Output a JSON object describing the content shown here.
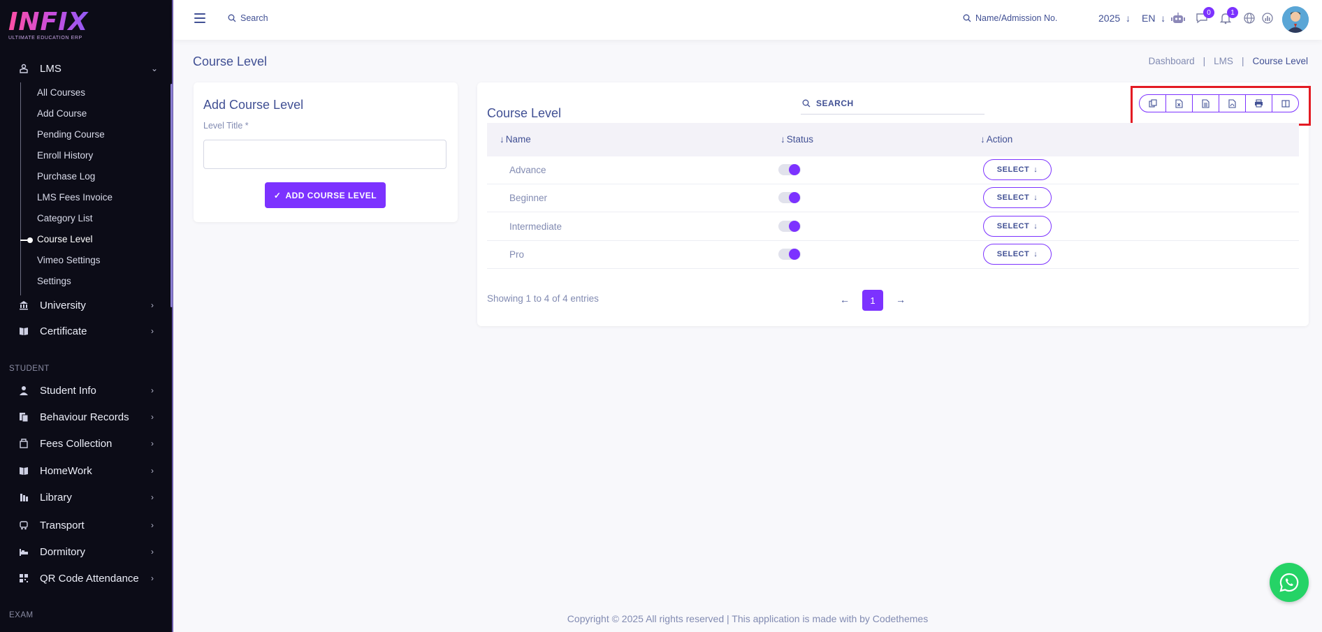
{
  "app": {
    "logo_text": "INFIX",
    "logo_subtitle": "ULTIMATE EDUCATION ERP"
  },
  "sidebar": {
    "lms": {
      "label": "LMS",
      "icon": "lms-icon"
    },
    "lms_sub_items": [
      {
        "label": "All Courses"
      },
      {
        "label": "Add Course"
      },
      {
        "label": "Pending Course"
      },
      {
        "label": "Enroll History"
      },
      {
        "label": "Purchase Log"
      },
      {
        "label": "LMS Fees Invoice"
      },
      {
        "label": "Category List"
      },
      {
        "label": "Course Level",
        "active": true
      },
      {
        "label": "Vimeo Settings"
      },
      {
        "label": "Settings"
      }
    ],
    "items_top": [
      {
        "label": "University",
        "icon": "university-icon"
      },
      {
        "label": "Certificate",
        "icon": "certificate-icon"
      }
    ],
    "section_student": "STUDENT",
    "items_student": [
      {
        "label": "Student Info",
        "icon": "student-icon"
      },
      {
        "label": "Behaviour Records",
        "icon": "records-icon"
      },
      {
        "label": "Fees Collection",
        "icon": "fees-icon"
      },
      {
        "label": "HomeWork",
        "icon": "homework-icon"
      },
      {
        "label": "Library",
        "icon": "library-icon"
      },
      {
        "label": "Transport",
        "icon": "transport-icon"
      },
      {
        "label": "Dormitory",
        "icon": "dormitory-icon"
      },
      {
        "label": "QR Code Attendance",
        "icon": "qr-code-icon"
      }
    ],
    "section_exam": "EXAM"
  },
  "topbar": {
    "search_placeholder": "Search",
    "search2_placeholder": "Name/Admission No.",
    "year": "2025",
    "language": "EN",
    "messages_count": "0",
    "notifications_count": "1"
  },
  "page": {
    "title": "Course Level",
    "breadcrumb": [
      "Dashboard",
      "LMS",
      "Course Level"
    ]
  },
  "add_form": {
    "title": "Add Course Level",
    "field_label": "Level Title *",
    "field_value": "",
    "submit_label": "ADD COURSE LEVEL"
  },
  "table": {
    "title": "Course Level",
    "search_placeholder": "SEARCH",
    "export_buttons": [
      "copy-icon",
      "excel-icon",
      "csv-icon",
      "pdf-icon",
      "print-icon",
      "columns-icon"
    ],
    "columns": [
      "Name",
      "Status",
      "Action"
    ],
    "rows": [
      {
        "name": "Advance",
        "status": "on",
        "action": "SELECT"
      },
      {
        "name": "Beginner",
        "status": "on",
        "action": "SELECT"
      },
      {
        "name": "Intermediate",
        "status": "on",
        "action": "SELECT"
      },
      {
        "name": "Pro",
        "status": "on",
        "action": "SELECT"
      }
    ],
    "summary": "Showing 1 to 4 of 4 entries",
    "current_page": "1"
  },
  "footer": {
    "text": "Copyright © 2025 All rights reserved | This application is made with by Codethemes"
  },
  "colors": {
    "accent": "#7c32ff",
    "sidebar_bg": "#0c0c17",
    "text": "#415094",
    "muted": "#828bb2",
    "highlight": "#e31b23",
    "whatsapp": "#25d366"
  }
}
